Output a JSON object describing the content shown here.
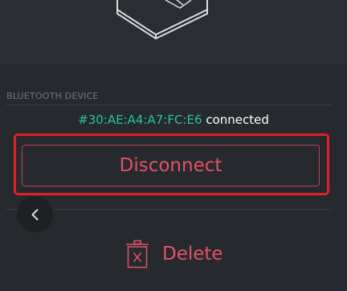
{
  "bluetooth": {
    "section_label": "BLUETOOTH DEVICE",
    "device_address": "#30:AE:A4:A7:FC:E6",
    "status_text": "connected"
  },
  "actions": {
    "disconnect_label": "Disconnect",
    "delete_label": "Delete"
  },
  "icons": {
    "back": "chevron-left-icon",
    "delete": "trash-icon",
    "illustration": "hardware-device-illustration"
  },
  "colors": {
    "background": "#26292d",
    "address": "#27c49a",
    "danger": "#e35268",
    "highlight": "#e21f2a"
  }
}
